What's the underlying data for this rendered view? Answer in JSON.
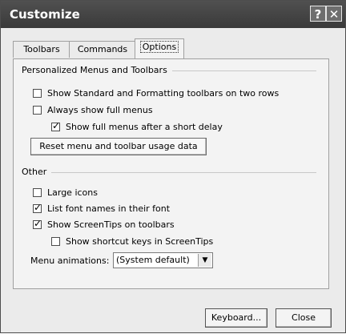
{
  "window": {
    "title": "Customize"
  },
  "title_buttons": {
    "help": "?",
    "close": "✕"
  },
  "tabs": [
    {
      "label": "Toolbars"
    },
    {
      "label": "Commands"
    },
    {
      "label": "Options"
    }
  ],
  "personalized": {
    "heading": "Personalized Menus and Toolbars",
    "items": [
      {
        "label": "Show Standard and Formatting toolbars on two rows",
        "checked": false
      },
      {
        "label": "Always show full menus",
        "checked": false
      },
      {
        "label": "Show full menus after a short delay",
        "checked": true
      }
    ],
    "reset_button": "Reset menu and toolbar usage data"
  },
  "other": {
    "heading": "Other",
    "items": [
      {
        "label": "Large icons",
        "checked": false
      },
      {
        "label": "List font names in their font",
        "checked": true
      },
      {
        "label": "Show ScreenTips on toolbars",
        "checked": true
      },
      {
        "label": "Show shortcut keys in ScreenTips",
        "checked": false
      }
    ],
    "menu_animations_label": "Menu animations:",
    "menu_animations_value": "(System default)"
  },
  "footer": {
    "keyboard_button": "Keyboard...",
    "close_button": "Close"
  }
}
